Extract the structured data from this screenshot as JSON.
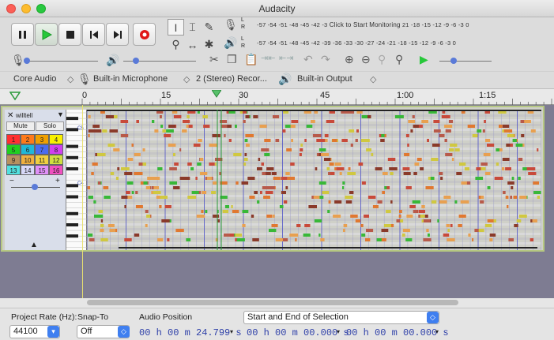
{
  "window": {
    "title": "Audacity"
  },
  "meters": {
    "record_scale": "-57 -54 -51 -48 -45 -42 -3",
    "record_prompt": "Click to Start Monitoring",
    "record_scale_tail": "21 -18 -15 -12 -9 -6 -3 0",
    "play_scale": "-57 -54 -51 -48 -45 -42 -39 -36 -33 -30 -27 -24 -21 -18 -15 -12 -9 -6 -3 0",
    "ch_l": "L",
    "ch_r": "R"
  },
  "devices": {
    "host": "Core Audio",
    "input": "Built-in Microphone",
    "channels": "2 (Stereo) Recor...",
    "output": "Built-in Output"
  },
  "ruler": {
    "labels": [
      "0",
      "15",
      "30",
      "45",
      "1:00",
      "1:15"
    ]
  },
  "track": {
    "name": "willtell",
    "mute_label": "Mute",
    "solo_label": "Solo",
    "channels": [
      "1",
      "2",
      "3",
      "4",
      "5",
      "6",
      "7",
      "8",
      "9",
      "10",
      "11",
      "12",
      "13",
      "14",
      "15",
      "16"
    ],
    "channel_colors": [
      "#ff3030",
      "#ff7a1a",
      "#f0a000",
      "#f8f000",
      "#20d020",
      "#20b8d8",
      "#4a6cf0",
      "#d040f0",
      "#b89060",
      "#f0b040",
      "#f0d040",
      "#d0e040",
      "#50e0e0",
      "#d8d8f8",
      "#e090f8",
      "#f050c0"
    ],
    "velocity_minus": "−",
    "velocity_plus": "+",
    "pitch_labels": [
      "C5",
      "C4"
    ]
  },
  "selection": {
    "project_rate_label": "Project Rate (Hz):",
    "project_rate": "44100",
    "snap_label": "Snap-To",
    "snap_value": "Off",
    "position_label": "Audio Position",
    "position_value": "00 h 00 m 24.799 s",
    "sel_mode": "Start and End of Selection",
    "sel_start": "00 h 00 m 00.000 s",
    "sel_end": "00 h 00 m 00.000 s"
  }
}
